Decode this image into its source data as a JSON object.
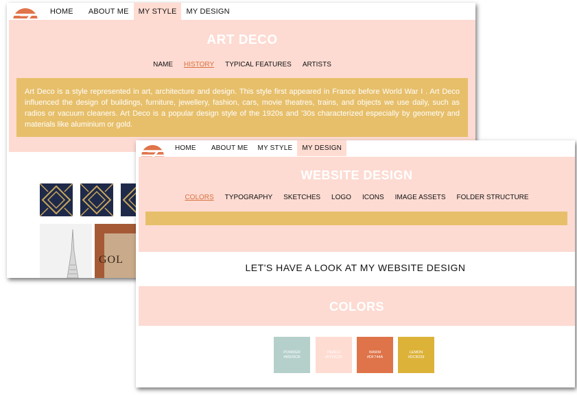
{
  "colors": {
    "pink": "#fddbd2",
    "gold": "#e7bf6a",
    "accent": "#d8703f",
    "powder": "#B5D0CB",
    "peach": "#FFDCD2",
    "warm": "#DF744A",
    "lemon": "#DCB239"
  },
  "back": {
    "nav": [
      "HOME",
      "ABOUT ME",
      "MY STYLE",
      "MY DESIGN"
    ],
    "active_nav": "MY STYLE",
    "title": "ART DECO",
    "subnav": [
      "NAME",
      "HISTORY",
      "TYPICAL FEATURES",
      "ARTISTS"
    ],
    "active_subnav": "HISTORY",
    "paragraph": "Art Deco is a style represented in art, architecture and design. This style first appeared in France before World War I . Art Deco influenced the design of buildings, furniture, jewellery, fashion, cars, movie theatres, trains, and objects we use daily, such as radios or vacuum cleaners. Art Deco is a popular design style of the 1920s and '30s characterized especially by geometry and materials like aluminium or gold.",
    "gallery_text": "GOL"
  },
  "front": {
    "nav": [
      "HOME",
      "ABOUT ME",
      "MY STYLE",
      "MY DESIGN"
    ],
    "active_nav": "MY DESIGN",
    "title": "WEBSITE DESIGN",
    "subnav": [
      "COLORS",
      "TYPOGRAPHY",
      "SKETCHES",
      "LOGO",
      "ICONS",
      "IMAGE ASSETS",
      "FOLDER STRUCTURE"
    ],
    "active_subnav": "COLORS",
    "heading": "LET'S HAVE A LOOK AT MY WEBSITE DESIGN",
    "colors_title": "COLORS",
    "swatches": [
      {
        "name": "POWDER",
        "hex": "#B5D0CB"
      },
      {
        "name": "PEACH",
        "hex": "#FFDCD2"
      },
      {
        "name": "WARM",
        "hex": "#DF744A"
      },
      {
        "name": "LEMON",
        "hex": "#DCB239"
      }
    ]
  }
}
